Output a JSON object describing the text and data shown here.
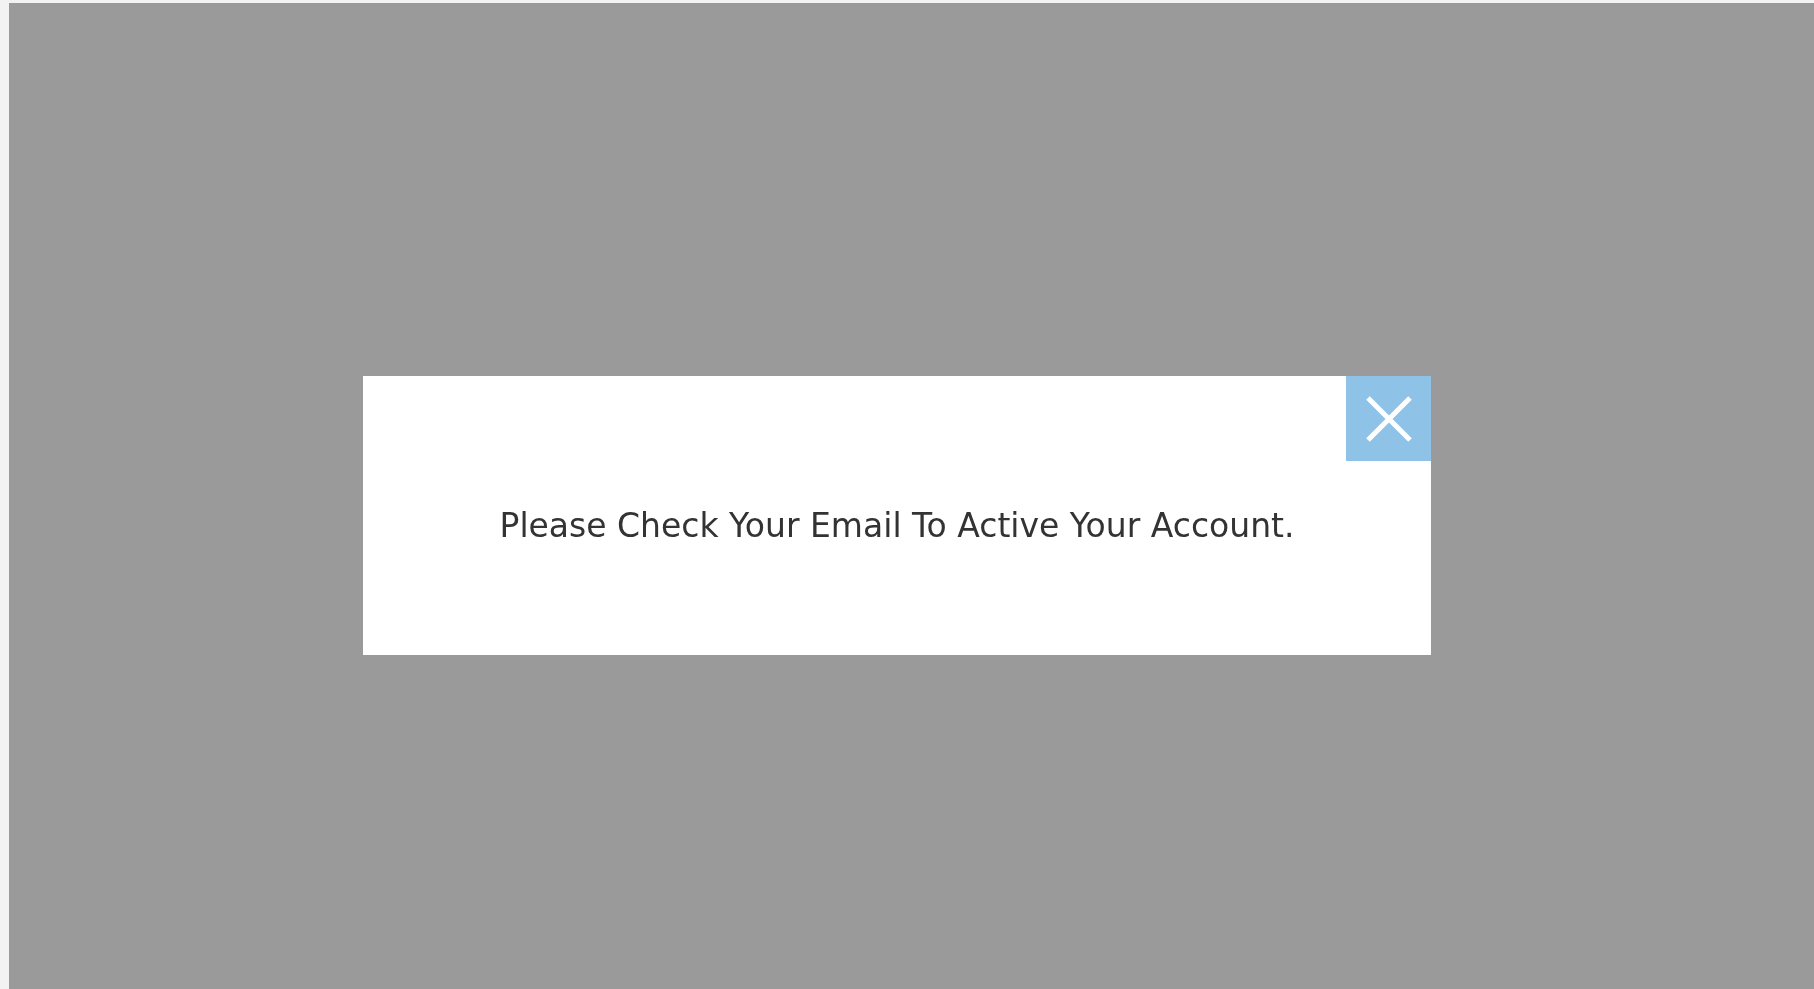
{
  "dialog": {
    "message": "Please Check Your Email To Active Your Account."
  }
}
